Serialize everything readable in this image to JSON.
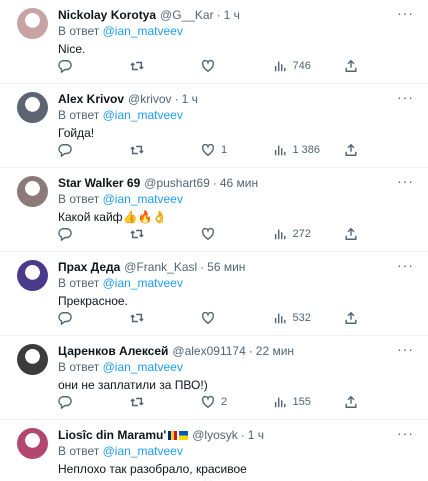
{
  "reply_prefix": "В ответ",
  "colors": {
    "accent": "#1d9bf0",
    "muted": "#536471",
    "text": "#0f1419",
    "divider": "#eff3f4"
  },
  "replies": [
    {
      "name": "Nickolay Korotya",
      "handle": "@G__Kar",
      "time": "1 ч",
      "mention": "@ian_matveev",
      "text": "Nice.",
      "likes": "",
      "views": "746",
      "avatar_color": "#c9a3a3",
      "more_icon": "more-icon"
    },
    {
      "name": "Alex Krivov",
      "handle": "@krivov",
      "time": "1 ч",
      "mention": "@ian_matveev",
      "text": "Гойда!",
      "likes": "1",
      "views": "1 386",
      "avatar_color": "#5b6470",
      "more_icon": "more-icon"
    },
    {
      "name": "Star Walker 69",
      "handle": "@pushart69",
      "time": "46 мин",
      "mention": "@ian_matveev",
      "text": "Какой кайф👍🔥👌",
      "likes": "",
      "views": "272",
      "avatar_color": "#8c7a78",
      "more_icon": "more-icon"
    },
    {
      "name": "Прах Деда",
      "handle": "@Frank_Kasl",
      "time": "56 мин",
      "mention": "@ian_matveev",
      "text": "Прекрасное.",
      "likes": "",
      "views": "532",
      "avatar_color": "#4a3a8a",
      "more_icon": "more-icon"
    },
    {
      "name": "Царенков Алексей",
      "handle": "@alex091174",
      "time": "22 мин",
      "mention": "@ian_matveev",
      "text": "они не заплатили за ПВО!)",
      "likes": "2",
      "views": "155",
      "avatar_color": "#3c3c3c",
      "more_icon": "more-icon"
    },
    {
      "name": "Liosîc din Maramu'",
      "handle": "@lyosyk",
      "time": "1 ч",
      "mention": "@ian_matveev",
      "text": "Неплохо так разобрало, красивое",
      "likes": "",
      "views": "",
      "avatar_color": "#b3476e",
      "more_icon": "more-icon"
    }
  ]
}
